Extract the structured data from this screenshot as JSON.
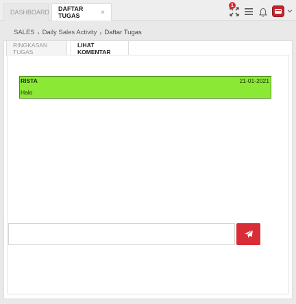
{
  "tabs": {
    "dashboard": "DASHBOARD",
    "task_list": "DAFTAR TUGAS",
    "close_symbol": "×"
  },
  "header": {
    "notification_count": "1",
    "icons": [
      "fullscreen-icon",
      "menu-icon",
      "bell-icon",
      "avatar",
      "chevron-down-icon"
    ]
  },
  "breadcrumb": {
    "items": [
      "SALES",
      "Daily Sales Activity",
      "Daftar Tugas"
    ],
    "separator": "›"
  },
  "subtabs": {
    "summary": "RINGKASAN TUGAS",
    "comments": "LIHAT KOMENTAR"
  },
  "comments": [
    {
      "author": "RISTA",
      "date": "21-01-2021",
      "text": "Halo"
    }
  ],
  "composer": {
    "value": "",
    "placeholder": ""
  },
  "colors": {
    "accent": "#d82d37",
    "comment_bg": "#8be834",
    "comment_border": "#4a8a1c"
  }
}
